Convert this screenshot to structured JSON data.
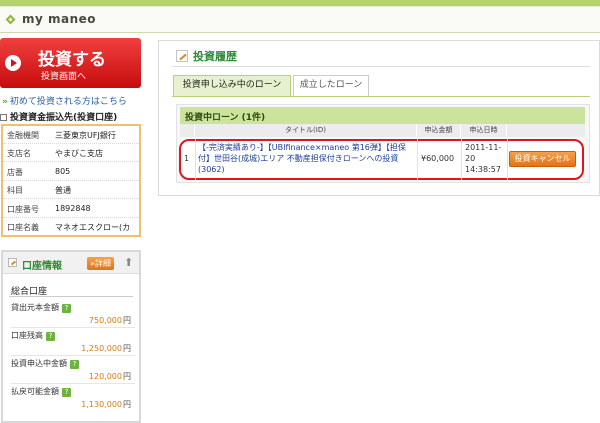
{
  "header": {
    "brand": "my maneo"
  },
  "sidebar": {
    "invest_button": {
      "main": "投資する",
      "sub": "投資画面へ"
    },
    "first_time_link": "初めて投資される方はこちら",
    "bank_title": "投資資金振込先(投資口座)",
    "bank_rows": [
      {
        "key": "金融機関",
        "value": "三菱東京UFJ銀行"
      },
      {
        "key": "支店名",
        "value": "やまびこ支店"
      },
      {
        "key": "店番",
        "value": "805"
      },
      {
        "key": "科目",
        "value": "普通"
      },
      {
        "key": "口座番号",
        "value": "1892848"
      },
      {
        "key": "口座名義",
        "value": "マネオエスクロー(カ"
      }
    ],
    "account": {
      "title": "口座情報",
      "detail_label": "詳細",
      "arrow": "⬆",
      "subtitle": "総合口座",
      "help_mark": "?",
      "unit": "円",
      "items": [
        {
          "label": "貸出元本金額",
          "value": "750,000"
        },
        {
          "label": "口座残高",
          "value": "1,250,000"
        },
        {
          "label": "投資申込中金額",
          "value": "120,000"
        },
        {
          "label": "払戻可能金額",
          "value": "1,130,000"
        }
      ]
    }
  },
  "main": {
    "page_title": "投資履歴",
    "tabs": [
      {
        "label": "投資申し込み中のローン",
        "active": true
      },
      {
        "label": "成立したローン",
        "active": false
      }
    ],
    "section_title": "投資中ローン (1件)",
    "columns": [
      "タイトル(ID)",
      "申込金額",
      "申込日時"
    ],
    "rows": [
      {
        "index": "1",
        "title": "【-完済実績あり-】【UBIfinance×maneo 第16弾】【担保付】世田谷(成城)エリア 不動産担保付きローンへの投資(3062)",
        "amount": "¥60,000",
        "date": "2011-11-20 14:38:57",
        "cancel_label": "投資キャンセル"
      }
    ]
  },
  "colors": {
    "accent_green": "#2e8b3a",
    "invest_red": "#d31515",
    "cancel_orange": "#e07416",
    "highlight_red": "#e0151f"
  }
}
